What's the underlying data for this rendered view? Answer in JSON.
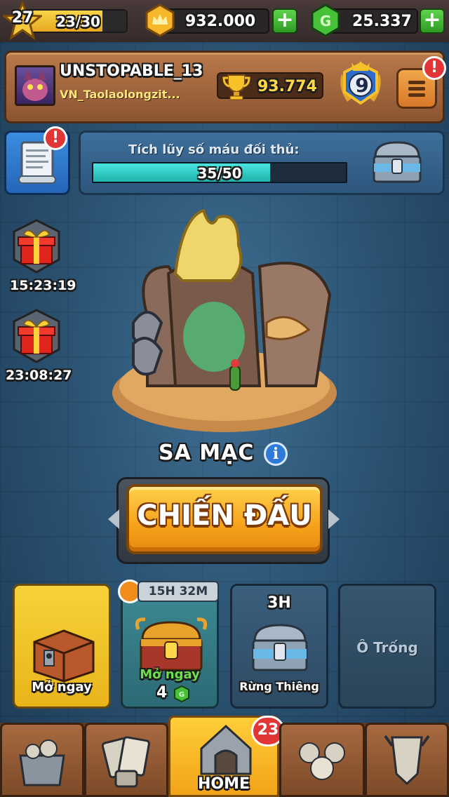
{
  "player": {
    "level": "27",
    "xp": "23/30",
    "xp_fraction": 0.77,
    "name": "UNSTOPABLE_13",
    "clan": "VN_Taolaolongzit...",
    "trophies": "93.774",
    "rank": "9"
  },
  "resources": {
    "gold": "932.000",
    "gems": "25.337",
    "plus_label": "+"
  },
  "alerts": {
    "exclaim": "!"
  },
  "banner": {
    "title": "Tích lũy số máu đối thủ:",
    "progress": "35/50",
    "progress_fraction": 0.7
  },
  "gifts": [
    {
      "timer": "15:23:19"
    },
    {
      "timer": "23:08:27"
    }
  ],
  "arena": {
    "name": "SA MẠC",
    "info_label": "i"
  },
  "battle": {
    "label": "CHIẾN ĐẤU"
  },
  "chests": [
    {
      "label": "Mở ngay"
    },
    {
      "timer": "15H 32M",
      "label": "Mở ngay",
      "cost": "4"
    },
    {
      "top": "3H",
      "label": "Rừng Thiêng"
    },
    {
      "label": "Ô Trống"
    }
  ],
  "nav": {
    "home_label": "HOME",
    "badge": "23"
  },
  "colors": {
    "accent_orange": "#f7a21b",
    "progress_cyan": "#2fd1cb",
    "alert_red": "#e23535",
    "plus_green": "#3fb832"
  }
}
